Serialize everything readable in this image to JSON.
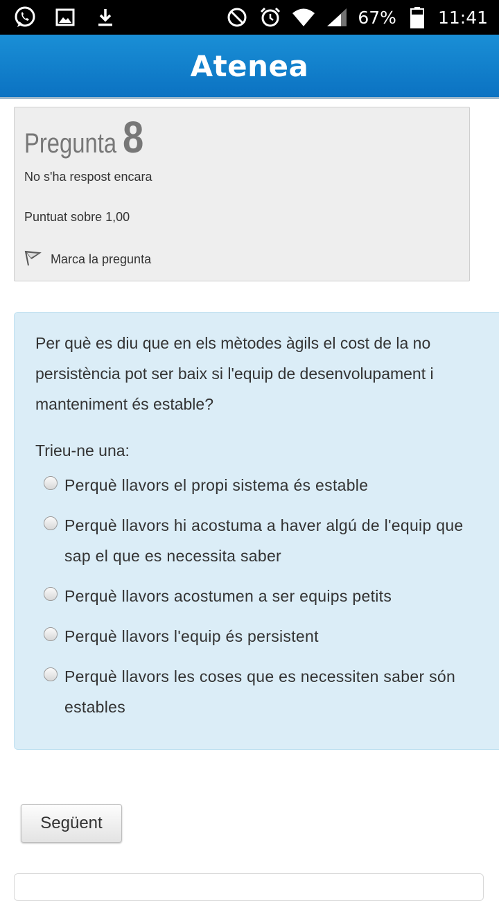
{
  "status_bar": {
    "icons_left": [
      "whatsapp-icon",
      "image-icon",
      "download-icon"
    ],
    "icons_right": [
      "do-not-disturb-icon",
      "alarm-icon",
      "wifi-icon",
      "signal-icon",
      "battery-icon"
    ],
    "battery": "67%",
    "time": "11:41"
  },
  "app": {
    "title": "Atenea",
    "accent": "#0b72c2"
  },
  "question": {
    "title_word": "Pregunta",
    "number": "8",
    "state": "No s'ha respost encara",
    "grade": "Puntuat sobre 1,00",
    "flag_label": "Marca la pregunta"
  },
  "formulation": {
    "text": "Per què es diu que en els mètodes àgils el cost de la no persistència pot ser baix si l'equip de desenvolupament i manteniment és estable?",
    "prompt": "Trieu-ne una:",
    "answers": [
      "Perquè llavors el propi sistema és estable",
      "Perquè llavors hi acostuma a haver algú de l'equip que sap el que es necessita saber",
      "Perquè llavors acostumen a ser equips petits",
      "Perquè llavors l'equip és persistent",
      "Perquè llavors les coses que es necessiten saber són estables"
    ],
    "background": "#dbedf7"
  },
  "navigation": {
    "next_label": "Següent"
  }
}
